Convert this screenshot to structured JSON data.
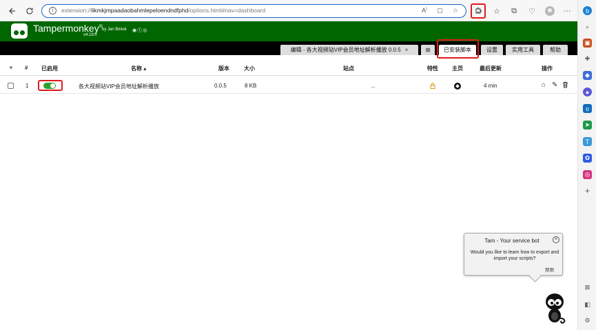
{
  "browser": {
    "url_prefix": "extension://",
    "url_host": "likmkjmpaadaobahmlepeloendndfphd",
    "url_path": "/options.html#nav=dashboard"
  },
  "app": {
    "title": "Tampermonkey",
    "trademark": "®",
    "author": "by Jan Biniok",
    "version": "v4.19.0",
    "brand_color": "#006600"
  },
  "tabs": [
    {
      "label": "编辑 - 各大视频站VIP会员地址解析播放 0.0.5",
      "close": "×"
    },
    {
      "label": "⊞"
    },
    {
      "label": "已安装脚本"
    },
    {
      "label": "设置"
    },
    {
      "label": "实用工具"
    },
    {
      "label": "帮助"
    }
  ],
  "table": {
    "headers": {
      "filter": "▼",
      "num": "#",
      "enabled": "已启用",
      "name": "名称 ▴",
      "version": "版本",
      "size": "大小",
      "sites": "站点",
      "features": "特性",
      "homepage": "主页",
      "updated": "最后更新",
      "actions": "操作"
    },
    "rows": [
      {
        "num": "1",
        "enabled": true,
        "name": "各大视频站VIP会员地址解析播放",
        "version": "0.0.5",
        "size": "8 KB",
        "sites": "...",
        "updated": "4 min"
      }
    ]
  },
  "bot": {
    "title": "Tam - Your service bot",
    "message": "Would you like to learn how to export and import your scripts?",
    "disable": "禁用",
    "close": "×"
  }
}
